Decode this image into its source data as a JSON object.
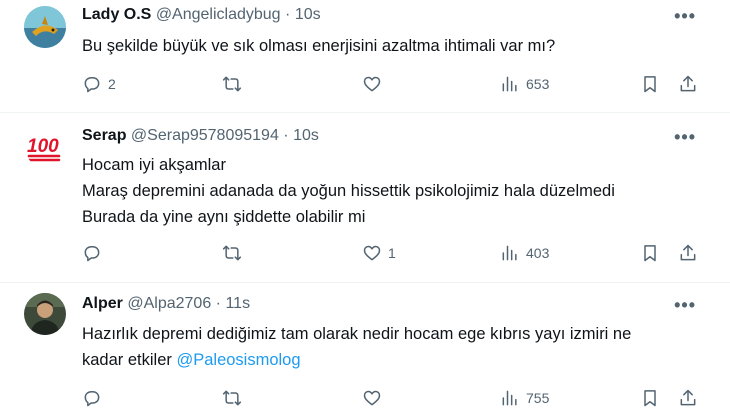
{
  "tweets": [
    {
      "name": "Lady O.S",
      "handle": "@Angelicladybug",
      "time": "10s",
      "lines": [
        "Bu şekilde büyük  ve sık olması enerjisini azaltma ihtimali var mı?"
      ],
      "replies": "2",
      "retweets": "",
      "likes": "",
      "views": "653",
      "avatar_icon": "shark-photo-avatar"
    },
    {
      "name": "Serap",
      "handle": "@Serap9578095194",
      "time": "10s",
      "lines": [
        "Hocam iyi akşamlar",
        "Maraş depremini adanada da yoğun hissettik psikolojimiz hala düzelmedi",
        "Burada da yine aynı şiddette olabilir mi"
      ],
      "replies": "",
      "retweets": "",
      "likes": "1",
      "views": "403",
      "avatar_icon": "hundred-points-emoji-avatar"
    },
    {
      "name": "Alper",
      "handle": "@Alpa2706",
      "time": "11s",
      "lines": [
        "Hazırlık depremi dediğimiz tam olarak nedir hocam ege kıbrıs yayı izmiri ne",
        "kadar etkiler "
      ],
      "mention": "@Paleosismolog",
      "replies": "",
      "retweets": "",
      "likes": "",
      "views": "755",
      "avatar_icon": "person-photo-avatar"
    }
  ],
  "ui": {
    "separator": "·",
    "more_glyph": "•••"
  },
  "colors": {
    "text": "#0f1419",
    "secondary": "#536471",
    "link": "#1d9bf0",
    "divider": "#eff3f4"
  }
}
